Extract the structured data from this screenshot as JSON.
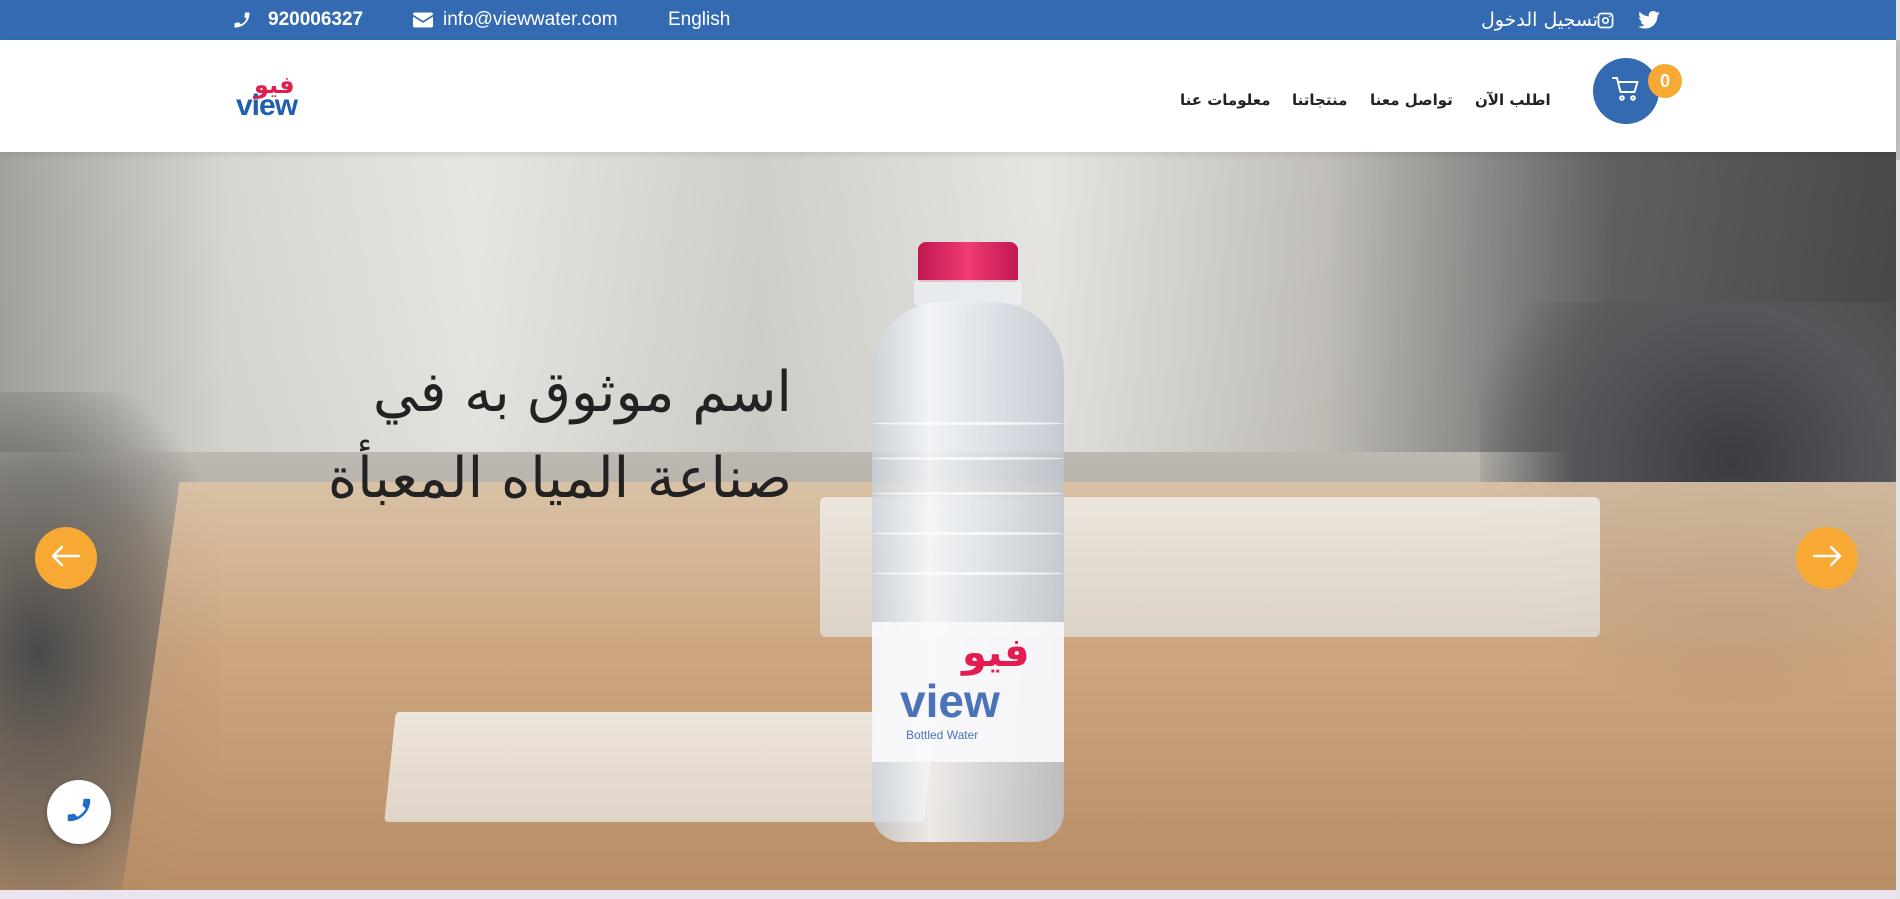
{
  "topbar": {
    "phone": "920006327",
    "email": "info@viewwater.com",
    "language": "English",
    "login": "تسجيل الدخول",
    "icons": [
      "phone-icon",
      "envelope-icon",
      "instagram-icon",
      "twitter-icon"
    ]
  },
  "header": {
    "logo_ar": "فيو",
    "logo_en": "view",
    "nav": {
      "about": "معلومات عنا",
      "products": "منتجاتنا",
      "contact": "تواصل معنا",
      "order": "اطلب الآن"
    },
    "cart_count": "0"
  },
  "hero": {
    "headline": "اسم موثوق به في صناعة المياه المعبأة",
    "bottle_label_ar": "فيو",
    "bottle_label_en": "view",
    "bottle_label_sub": "Bottled Water"
  },
  "colors": {
    "primary": "#336ab1",
    "accent": "#f7a933",
    "brand_red": "#e31b4e"
  }
}
